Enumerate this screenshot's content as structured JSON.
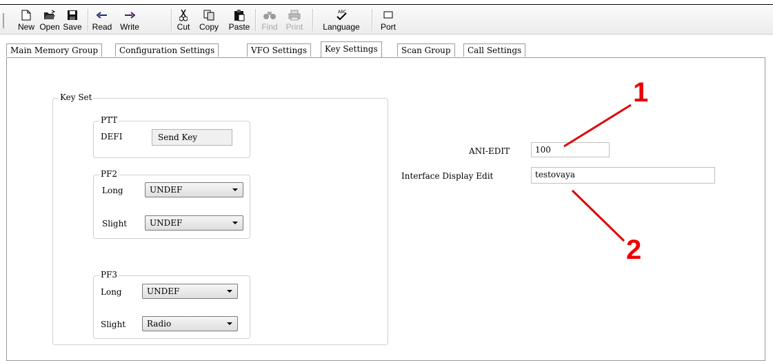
{
  "toolbar": {
    "buttons": [
      {
        "label": "New",
        "icon": "new-document-icon"
      },
      {
        "label": "Open",
        "icon": "open-folder-icon"
      },
      {
        "label": "Save",
        "icon": "save-disk-icon"
      },
      {
        "label": "Read",
        "icon": "arrow-left-icon"
      },
      {
        "label": "Write",
        "icon": "arrow-right-icon"
      },
      {
        "label": "Cut",
        "icon": "scissors-icon"
      },
      {
        "label": "Copy",
        "icon": "copy-icon"
      },
      {
        "label": "Paste",
        "icon": "paste-icon"
      },
      {
        "label": "Find",
        "icon": "binoculars-icon"
      },
      {
        "label": "Print",
        "icon": "printer-icon"
      },
      {
        "label": "Language",
        "icon": "spellcheck-icon"
      },
      {
        "label": "Port",
        "icon": "port-icon"
      }
    ]
  },
  "tabs": [
    "Main Memory Group",
    "Configuration Settings",
    "VFO Settings",
    "Key Settings",
    "Scan Group",
    "Call Settings"
  ],
  "active_tab": "Key Settings",
  "key_set": {
    "title": "Key Set",
    "ptt": {
      "title": "PTT",
      "defi_label": "DEFI",
      "defi_value": "Send Key"
    },
    "pf2": {
      "title": "PF2",
      "long_label": "Long",
      "long_value": "UNDEF",
      "slight_label": "Slight",
      "slight_value": "UNDEF"
    },
    "pf3": {
      "title": "PF3",
      "long_label": "Long",
      "long_value": "UNDEF",
      "slight_label": "Slight",
      "slight_value": "Radio"
    }
  },
  "ani_edit": {
    "label": "ANI-EDIT",
    "value": "100"
  },
  "interface_display_edit": {
    "label": "Interface Display Edit",
    "value": "testovaya"
  },
  "annotations": [
    "1",
    "2"
  ],
  "colors": {
    "annotation": "#e00000"
  }
}
